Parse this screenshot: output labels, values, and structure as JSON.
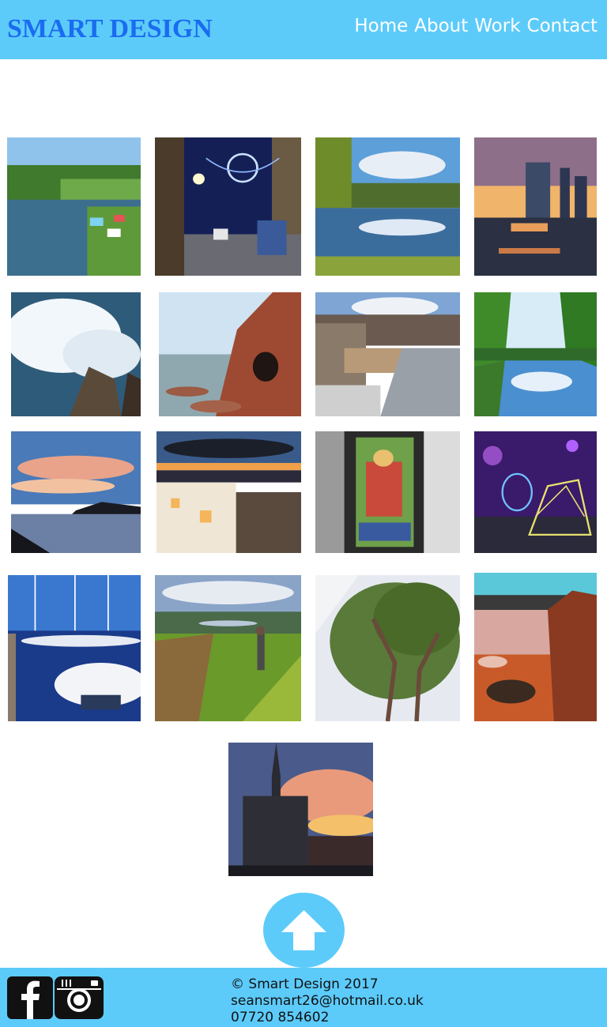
{
  "header": {
    "brand": "SMART DESIGN",
    "nav": [
      "Home",
      "About",
      "Work",
      "Contact"
    ]
  },
  "gallery": {
    "photos": [
      {
        "name": "river-with-pedal-boats-photo"
      },
      {
        "name": "city-street-christmas-lights-photo"
      },
      {
        "name": "river-autumn-trees-photo"
      },
      {
        "name": "waterfront-sunset-buildings-photo"
      },
      {
        "name": "crashing-wave-on-rocks-photo"
      },
      {
        "name": "red-sea-cliff-cave-photo"
      },
      {
        "name": "city-rooftops-view-photo"
      },
      {
        "name": "river-reflection-trees-photo"
      },
      {
        "name": "coastal-sunset-sky-photo"
      },
      {
        "name": "town-night-sunset-photo"
      },
      {
        "name": "building-light-projection-photo"
      },
      {
        "name": "neon-light-sculpture-photo"
      },
      {
        "name": "marina-boats-photo"
      },
      {
        "name": "man-on-hilltop-photo"
      },
      {
        "name": "tree-canopy-photo"
      },
      {
        "name": "red-rocky-shore-photo"
      },
      {
        "name": "church-spire-sunset-photo"
      }
    ]
  },
  "back_to_top": {
    "icon": "arrow-up-icon"
  },
  "footer": {
    "copyright": "© Smart Design 2017",
    "email": "seansmart26@hotmail.co.uk",
    "phone": "07720 854602",
    "social": [
      "facebook-icon",
      "instagram-icon"
    ]
  },
  "colors": {
    "header_bg": "#5ccbfa",
    "brand": "#1a6cf0",
    "nav_text": "#ffffff",
    "footer_bg": "#5ccbfa"
  }
}
